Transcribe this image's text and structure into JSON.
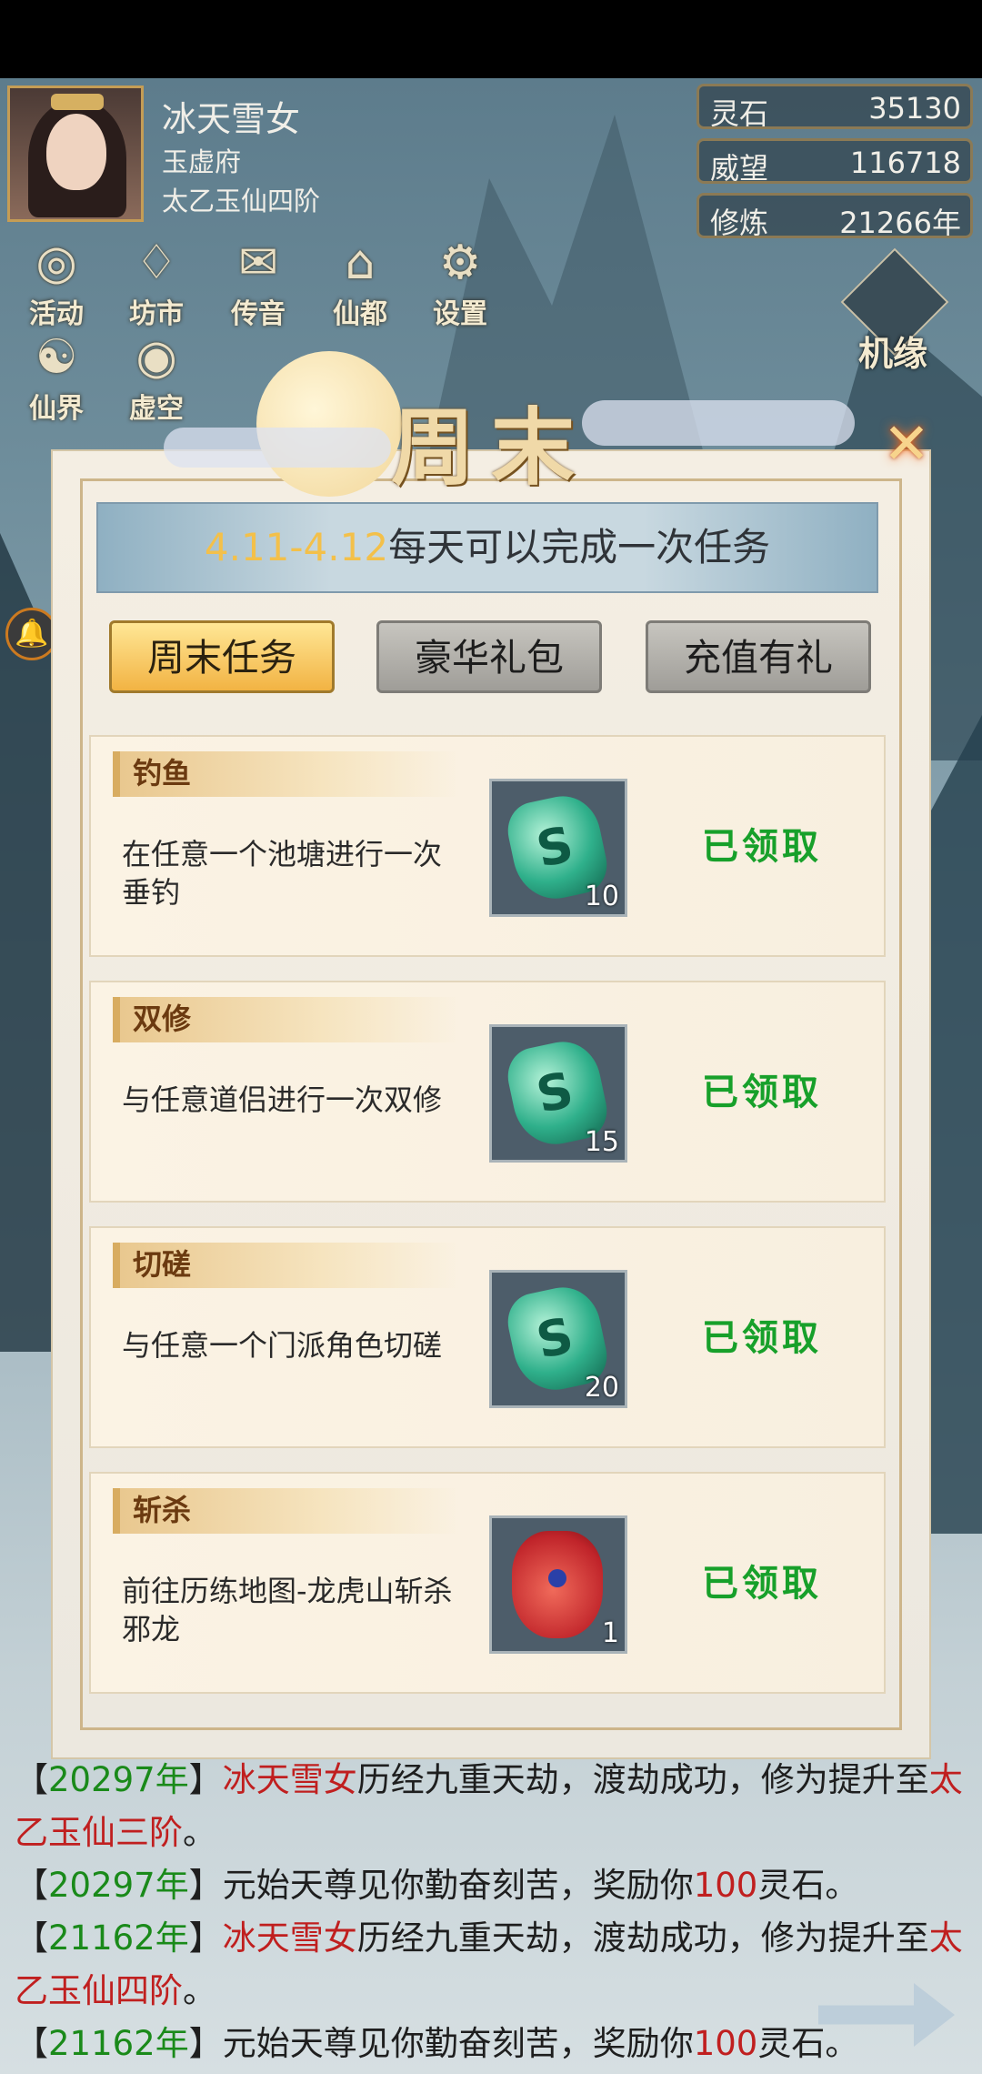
{
  "profile": {
    "name": "冰天雪女",
    "sect": "玉虚府",
    "rank": "太乙玉仙四阶"
  },
  "stats": [
    {
      "label": "灵石",
      "value": "35130"
    },
    {
      "label": "威望",
      "value": "116718"
    },
    {
      "label": "修炼",
      "value": "21266年"
    }
  ],
  "menu": [
    {
      "label": "活动",
      "icon": "activity-icon",
      "glyph": "◎"
    },
    {
      "label": "坊市",
      "icon": "market-icon",
      "glyph": "♢"
    },
    {
      "label": "传音",
      "icon": "mail-icon",
      "glyph": "✉"
    },
    {
      "label": "仙都",
      "icon": "city-icon",
      "glyph": "⌂"
    },
    {
      "label": "设置",
      "icon": "gear-icon",
      "glyph": "⚙"
    },
    {
      "label": "仙界",
      "icon": "immortal-realm-icon",
      "glyph": "☯"
    },
    {
      "label": "虚空",
      "icon": "void-icon",
      "glyph": "◉"
    }
  ],
  "jiyuan": {
    "label": "机缘",
    "icon": "fortune-icon"
  },
  "modal": {
    "title": "周末",
    "banner": {
      "date": "4.11-4.12",
      "text": "每天可以完成一次任务"
    },
    "tabs": [
      {
        "label": "周末任务",
        "active": true
      },
      {
        "label": "豪华礼包",
        "active": false
      },
      {
        "label": "充值有礼",
        "active": false
      }
    ],
    "tasks": [
      {
        "title": "钓鱼",
        "desc": "在任意一个池塘进行一次垂钓",
        "reward": "spirit-stone-icon",
        "qty": "10",
        "status": "已领取"
      },
      {
        "title": "双修",
        "desc": "与任意道侣进行一次双修",
        "reward": "spirit-stone-icon",
        "qty": "15",
        "status": "已领取"
      },
      {
        "title": "切磋",
        "desc": "与任意一个门派角色切磋",
        "reward": "spirit-stone-icon",
        "qty": "20",
        "status": "已领取"
      },
      {
        "title": "斩杀",
        "desc": "前往历练地图-龙虎山斩杀邪龙",
        "reward": "gift-bag-icon",
        "qty": "1",
        "status": "已领取"
      }
    ]
  },
  "log": [
    {
      "open": "【",
      "year": "20297年",
      "close": "】",
      "who": "冰天雪女",
      "text1": "历经九重天劫，渡劫成功，修为提升至",
      "rank": "太乙玉仙三阶",
      "end": "。"
    },
    {
      "open": "【",
      "year": "20297年",
      "close": "】",
      "text1": "元始天尊见你勤奋刻苦，奖励你",
      "amount": "100",
      "text2": "灵石。"
    },
    {
      "open": "【",
      "year": "21162年",
      "close": "】",
      "who": "冰天雪女",
      "text1": "历经九重天劫，渡劫成功，修为提升至",
      "rank": "太乙玉仙四阶",
      "end": "。"
    },
    {
      "open": "【",
      "year": "21162年",
      "close": "】",
      "text1": "元始天尊见你勤奋刻苦，奖励你",
      "amount": "100",
      "text2": "灵石。"
    }
  ],
  "colors": {
    "claimed": "#17a02a",
    "year": "#1a8a1a",
    "highlight": "#c01f1f",
    "date": "#f3c04a"
  }
}
